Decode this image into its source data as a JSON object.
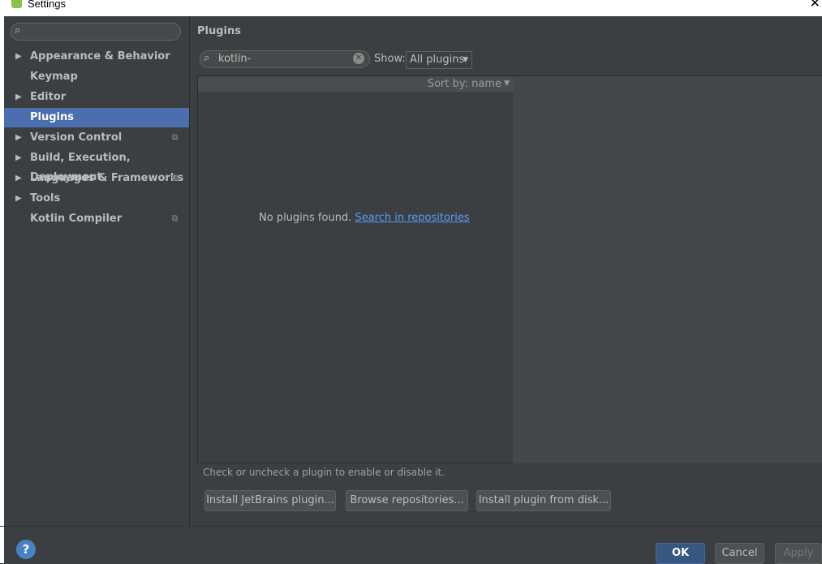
{
  "window": {
    "title": "Settings",
    "icon": "android-studio-icon",
    "close": "✕"
  },
  "sidebar": {
    "search_value": "",
    "items": [
      {
        "label": "Appearance & Behavior",
        "arrow": "▶",
        "copy": ""
      },
      {
        "label": "Keymap",
        "arrow": "",
        "copy": ""
      },
      {
        "label": "Editor",
        "arrow": "▶",
        "copy": ""
      },
      {
        "label": "Plugins",
        "arrow": "",
        "copy": ""
      },
      {
        "label": "Version Control",
        "arrow": "▶",
        "copy": "⧉"
      },
      {
        "label": "Build, Execution, Deployment",
        "arrow": "▶",
        "copy": ""
      },
      {
        "label": "Languages & Frameworks",
        "arrow": "▶",
        "copy": "⧉"
      },
      {
        "label": "Tools",
        "arrow": "▶",
        "copy": ""
      },
      {
        "label": "Kotlin Compiler",
        "arrow": "",
        "copy": "⧉"
      }
    ]
  },
  "main": {
    "title": "Plugins",
    "search_value": "kotlin-",
    "show_label": "Show:",
    "show_value": "All plugins",
    "sort_label": "Sort by: name",
    "empty_text": "No plugins found. ",
    "empty_link": "Search in repositories",
    "hint": "Check or uncheck a plugin to enable or disable it.",
    "buttons": {
      "install_jetbrains": "Install JetBrains plugin...",
      "browse": "Browse repositories...",
      "install_disk": "Install plugin from disk..."
    }
  },
  "footer": {
    "help": "?",
    "ok": "OK",
    "cancel": "Cancel",
    "apply": "Apply"
  },
  "colors": {
    "selected": "#4b6eaf",
    "link": "#589df6",
    "background": "#3c3f41"
  }
}
